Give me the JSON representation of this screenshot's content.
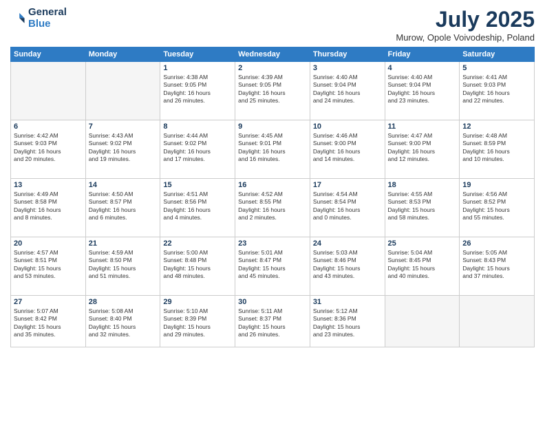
{
  "logo": {
    "general": "General",
    "blue": "Blue"
  },
  "title": {
    "month": "July 2025",
    "location": "Murow, Opole Voivodeship, Poland"
  },
  "weekdays": [
    "Sunday",
    "Monday",
    "Tuesday",
    "Wednesday",
    "Thursday",
    "Friday",
    "Saturday"
  ],
  "weeks": [
    [
      {
        "day": "",
        "info": ""
      },
      {
        "day": "",
        "info": ""
      },
      {
        "day": "1",
        "info": "Sunrise: 4:38 AM\nSunset: 9:05 PM\nDaylight: 16 hours\nand 26 minutes."
      },
      {
        "day": "2",
        "info": "Sunrise: 4:39 AM\nSunset: 9:05 PM\nDaylight: 16 hours\nand 25 minutes."
      },
      {
        "day": "3",
        "info": "Sunrise: 4:40 AM\nSunset: 9:04 PM\nDaylight: 16 hours\nand 24 minutes."
      },
      {
        "day": "4",
        "info": "Sunrise: 4:40 AM\nSunset: 9:04 PM\nDaylight: 16 hours\nand 23 minutes."
      },
      {
        "day": "5",
        "info": "Sunrise: 4:41 AM\nSunset: 9:03 PM\nDaylight: 16 hours\nand 22 minutes."
      }
    ],
    [
      {
        "day": "6",
        "info": "Sunrise: 4:42 AM\nSunset: 9:03 PM\nDaylight: 16 hours\nand 20 minutes."
      },
      {
        "day": "7",
        "info": "Sunrise: 4:43 AM\nSunset: 9:02 PM\nDaylight: 16 hours\nand 19 minutes."
      },
      {
        "day": "8",
        "info": "Sunrise: 4:44 AM\nSunset: 9:02 PM\nDaylight: 16 hours\nand 17 minutes."
      },
      {
        "day": "9",
        "info": "Sunrise: 4:45 AM\nSunset: 9:01 PM\nDaylight: 16 hours\nand 16 minutes."
      },
      {
        "day": "10",
        "info": "Sunrise: 4:46 AM\nSunset: 9:00 PM\nDaylight: 16 hours\nand 14 minutes."
      },
      {
        "day": "11",
        "info": "Sunrise: 4:47 AM\nSunset: 9:00 PM\nDaylight: 16 hours\nand 12 minutes."
      },
      {
        "day": "12",
        "info": "Sunrise: 4:48 AM\nSunset: 8:59 PM\nDaylight: 16 hours\nand 10 minutes."
      }
    ],
    [
      {
        "day": "13",
        "info": "Sunrise: 4:49 AM\nSunset: 8:58 PM\nDaylight: 16 hours\nand 8 minutes."
      },
      {
        "day": "14",
        "info": "Sunrise: 4:50 AM\nSunset: 8:57 PM\nDaylight: 16 hours\nand 6 minutes."
      },
      {
        "day": "15",
        "info": "Sunrise: 4:51 AM\nSunset: 8:56 PM\nDaylight: 16 hours\nand 4 minutes."
      },
      {
        "day": "16",
        "info": "Sunrise: 4:52 AM\nSunset: 8:55 PM\nDaylight: 16 hours\nand 2 minutes."
      },
      {
        "day": "17",
        "info": "Sunrise: 4:54 AM\nSunset: 8:54 PM\nDaylight: 16 hours\nand 0 minutes."
      },
      {
        "day": "18",
        "info": "Sunrise: 4:55 AM\nSunset: 8:53 PM\nDaylight: 15 hours\nand 58 minutes."
      },
      {
        "day": "19",
        "info": "Sunrise: 4:56 AM\nSunset: 8:52 PM\nDaylight: 15 hours\nand 55 minutes."
      }
    ],
    [
      {
        "day": "20",
        "info": "Sunrise: 4:57 AM\nSunset: 8:51 PM\nDaylight: 15 hours\nand 53 minutes."
      },
      {
        "day": "21",
        "info": "Sunrise: 4:59 AM\nSunset: 8:50 PM\nDaylight: 15 hours\nand 51 minutes."
      },
      {
        "day": "22",
        "info": "Sunrise: 5:00 AM\nSunset: 8:48 PM\nDaylight: 15 hours\nand 48 minutes."
      },
      {
        "day": "23",
        "info": "Sunrise: 5:01 AM\nSunset: 8:47 PM\nDaylight: 15 hours\nand 45 minutes."
      },
      {
        "day": "24",
        "info": "Sunrise: 5:03 AM\nSunset: 8:46 PM\nDaylight: 15 hours\nand 43 minutes."
      },
      {
        "day": "25",
        "info": "Sunrise: 5:04 AM\nSunset: 8:45 PM\nDaylight: 15 hours\nand 40 minutes."
      },
      {
        "day": "26",
        "info": "Sunrise: 5:05 AM\nSunset: 8:43 PM\nDaylight: 15 hours\nand 37 minutes."
      }
    ],
    [
      {
        "day": "27",
        "info": "Sunrise: 5:07 AM\nSunset: 8:42 PM\nDaylight: 15 hours\nand 35 minutes."
      },
      {
        "day": "28",
        "info": "Sunrise: 5:08 AM\nSunset: 8:40 PM\nDaylight: 15 hours\nand 32 minutes."
      },
      {
        "day": "29",
        "info": "Sunrise: 5:10 AM\nSunset: 8:39 PM\nDaylight: 15 hours\nand 29 minutes."
      },
      {
        "day": "30",
        "info": "Sunrise: 5:11 AM\nSunset: 8:37 PM\nDaylight: 15 hours\nand 26 minutes."
      },
      {
        "day": "31",
        "info": "Sunrise: 5:12 AM\nSunset: 8:36 PM\nDaylight: 15 hours\nand 23 minutes."
      },
      {
        "day": "",
        "info": ""
      },
      {
        "day": "",
        "info": ""
      }
    ]
  ]
}
